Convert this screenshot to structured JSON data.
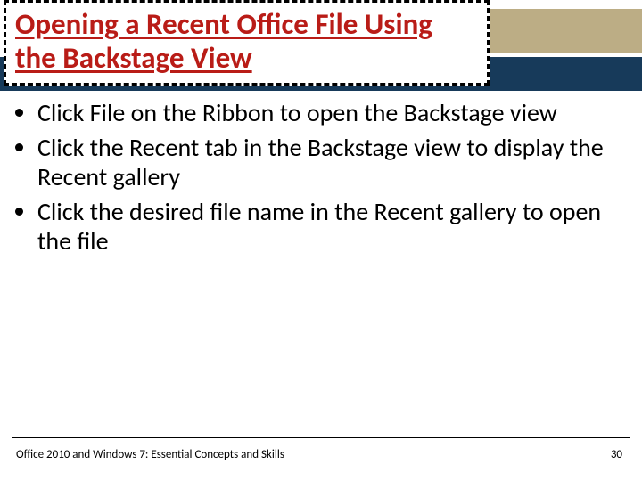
{
  "title": "Opening a Recent Office File Using the Backstage View",
  "bullets": [
    "Click File on the Ribbon to open the Backstage view",
    "Click the Recent tab in the Backstage view to display the Recent gallery",
    "Click the desired file name in the Recent gallery to open the file"
  ],
  "footer": {
    "text": "Office 2010 and Windows 7: Essential Concepts and Skills",
    "page": "30"
  },
  "colors": {
    "title": "#b91c17",
    "tan": "#bcad85",
    "navy": "#173a5a"
  }
}
